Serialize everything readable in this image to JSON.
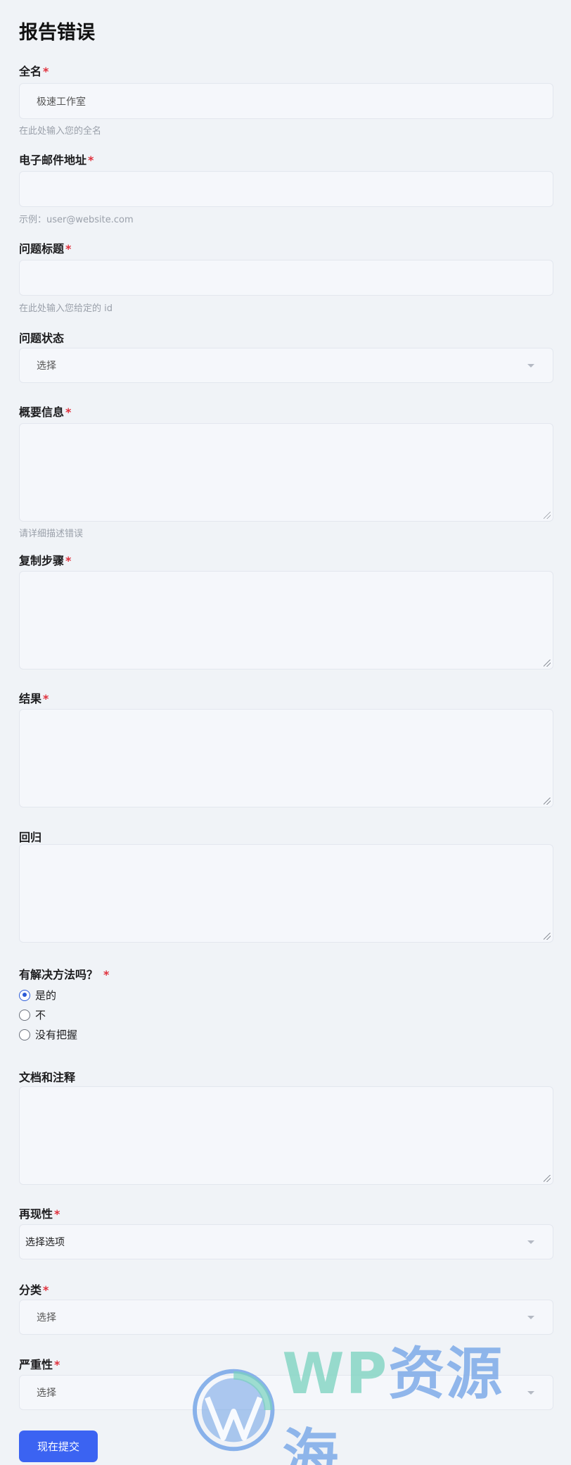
{
  "page": {
    "title": "报告错误"
  },
  "form": {
    "full_name": {
      "label": "全名",
      "required": "*",
      "value": "极速工作室",
      "hint": "在此处输入您的全名"
    },
    "email": {
      "label": "电子邮件地址",
      "required": "*",
      "value": "",
      "hint": "示例：user@website.com"
    },
    "issue_title": {
      "label": "问题标题",
      "required": "*",
      "value": "",
      "hint": "在此处输入您给定的 id"
    },
    "issue_status": {
      "label": "问题状态",
      "selected": "选择"
    },
    "summary": {
      "label": "概要信息",
      "required": "*",
      "hint": "请详细描述错误"
    },
    "repro_steps": {
      "label": "复制步骤",
      "required": "*"
    },
    "result": {
      "label": "结果",
      "required": "*"
    },
    "regression": {
      "label": "回归"
    },
    "workaround": {
      "label": "有解决方法吗？",
      "required": "*",
      "options": [
        {
          "label": "是的",
          "checked": true
        },
        {
          "label": "不",
          "checked": false
        },
        {
          "label": "没有把握",
          "checked": false
        }
      ]
    },
    "docs": {
      "label": "文档和注释"
    },
    "reproducibility": {
      "label": "再现性",
      "required": "*",
      "selected": "选择选项"
    },
    "category": {
      "label": "分类",
      "required": "*",
      "selected": "选择"
    },
    "severity": {
      "label": "严重性",
      "required": "*",
      "selected": "选择"
    },
    "submit_label": "现在提交"
  },
  "watermark": {
    "latin": "WP",
    "cn": "资源海"
  },
  "colors": {
    "accent": "#3b63f2",
    "required": "#e0303c",
    "background": "#f0f3f7"
  }
}
